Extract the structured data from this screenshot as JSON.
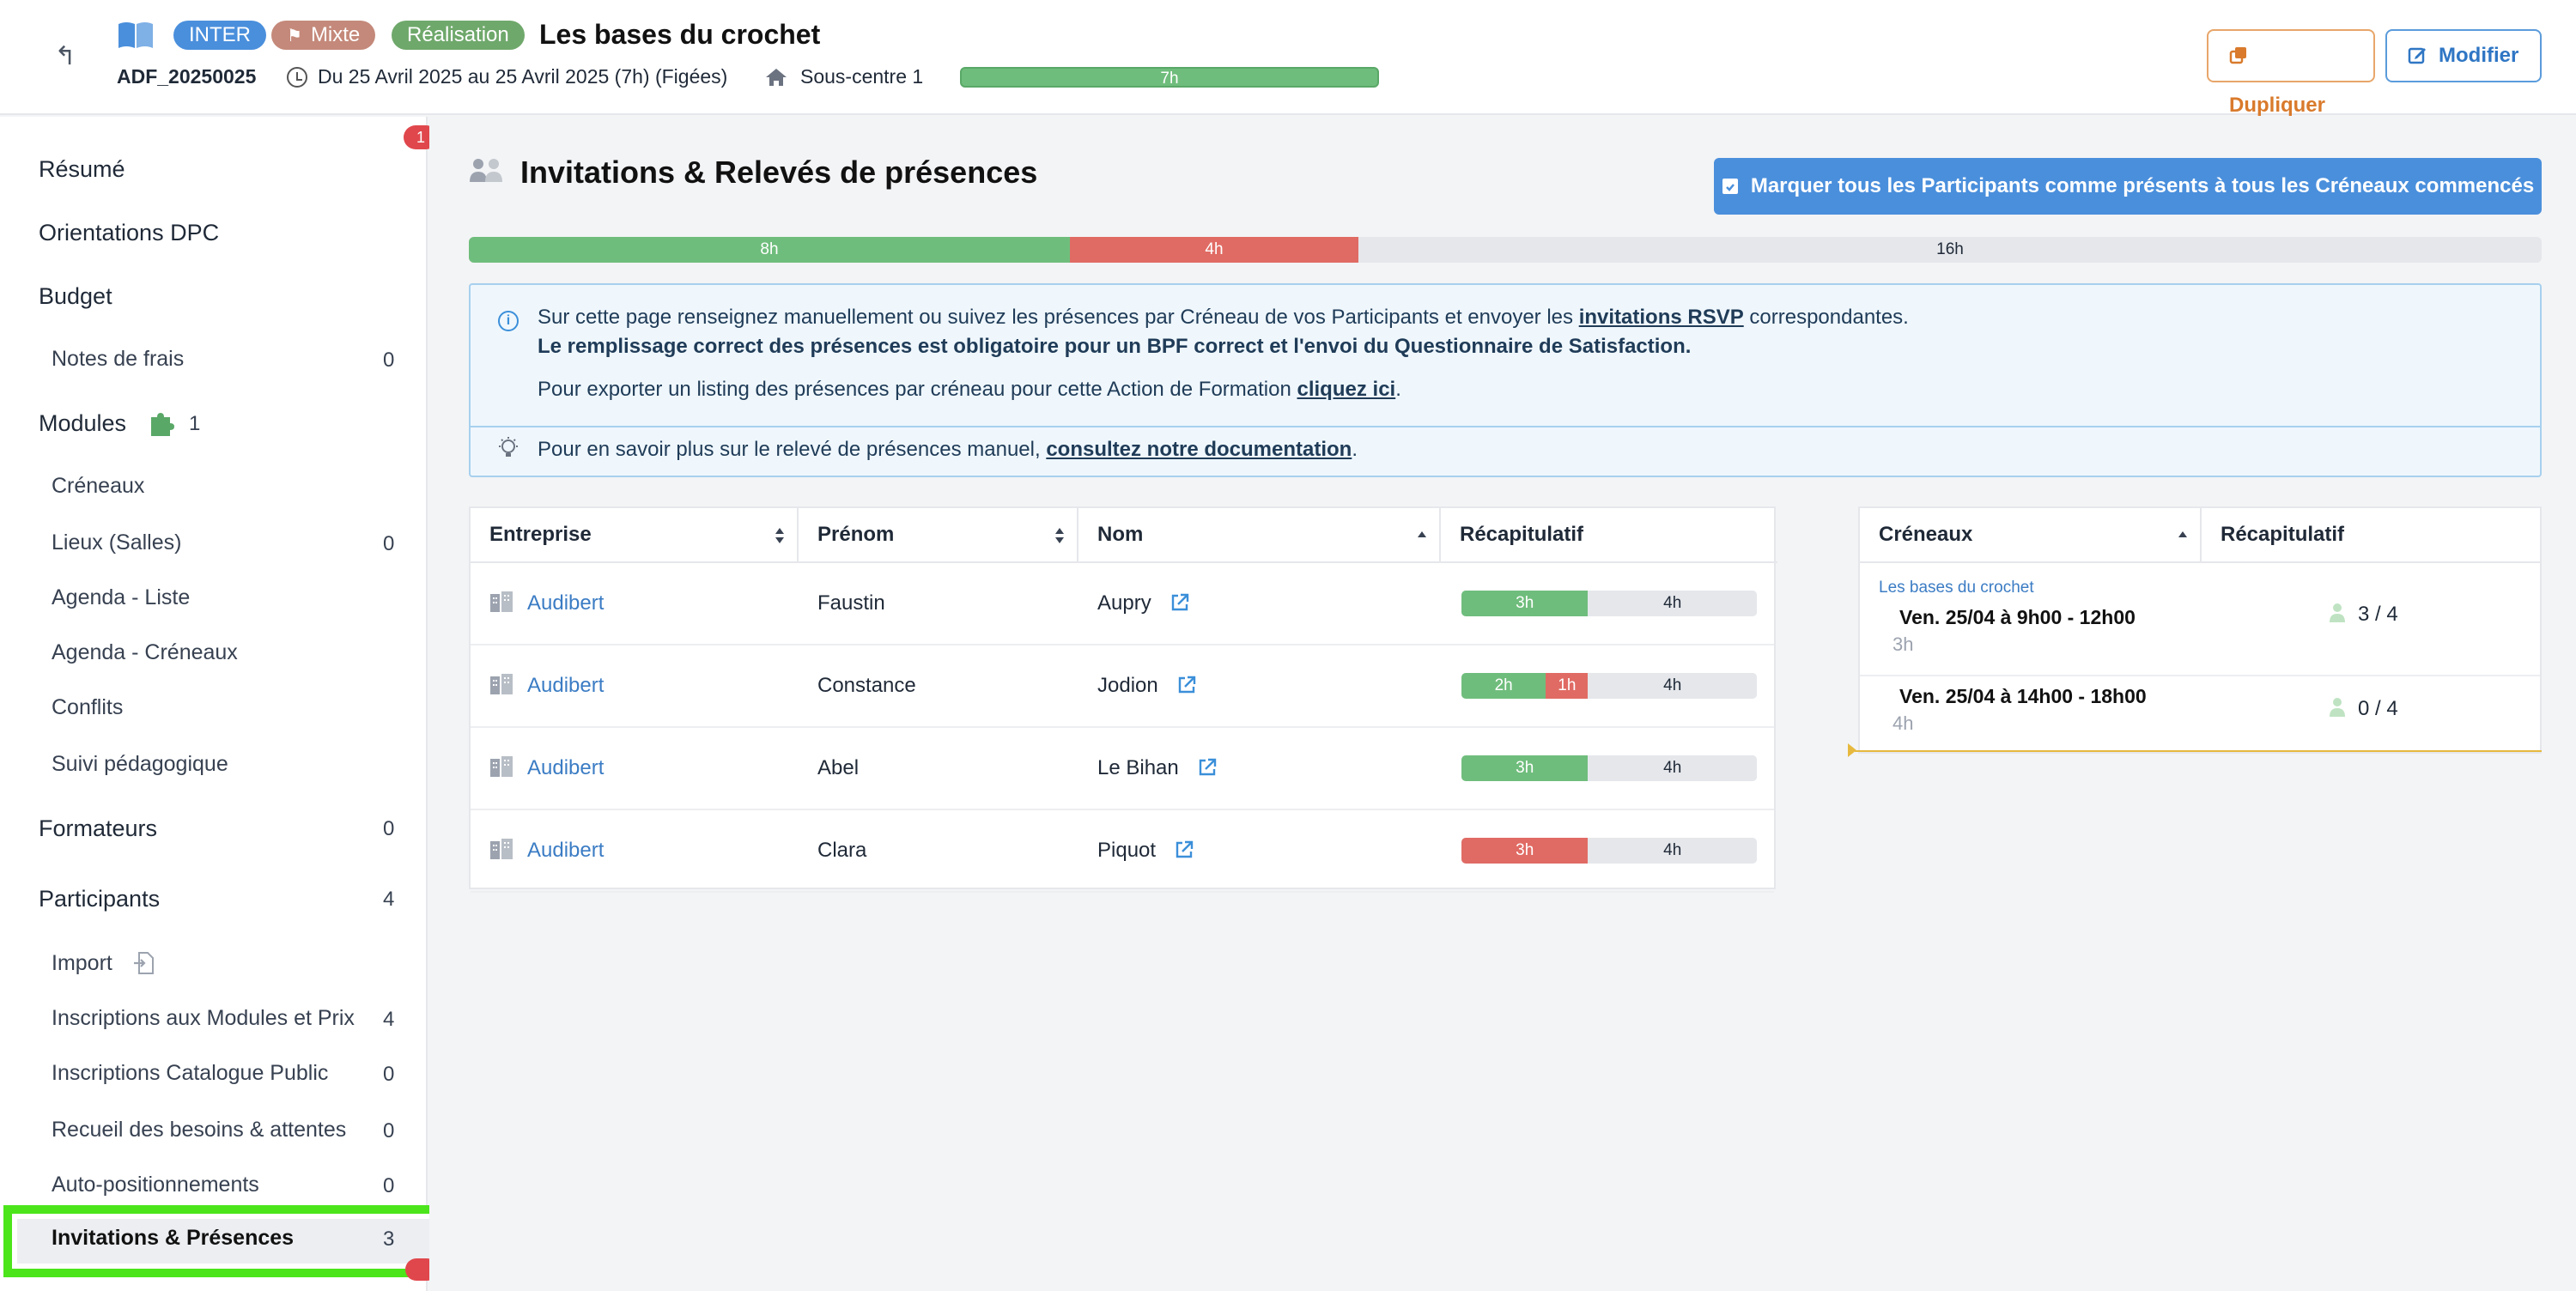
{
  "header": {
    "badges": {
      "inter": "INTER",
      "mixte": "Mixte",
      "realisation": "Réalisation"
    },
    "title": "Les bases du crochet",
    "ref": "ADF_20250025",
    "dates": "Du 25 Avril 2025 au 25 Avril 2025 (7h) (Figées)",
    "center": "Sous-centre 1",
    "progress_label": "7h",
    "duplicate_label": "Dupliquer",
    "modify_label": "Modifier"
  },
  "sidebar": {
    "notif_count": "1",
    "resume": "Résumé",
    "orientations": "Orientations DPC",
    "budget": "Budget",
    "notes": "Notes de frais",
    "notes_count": "0",
    "modules": "Modules",
    "modules_count": "1",
    "creneaux": "Créneaux",
    "lieux": "Lieux (Salles)",
    "lieux_count": "0",
    "agenda_liste": "Agenda - Liste",
    "agenda_creneaux": "Agenda - Créneaux",
    "conflits": "Conflits",
    "suivi": "Suivi pédagogique",
    "formateurs": "Formateurs",
    "formateurs_count": "0",
    "participants": "Participants",
    "participants_count": "4",
    "import": "Import",
    "inscriptions_modules": "Inscriptions aux Modules et Prix",
    "inscriptions_modules_count": "4",
    "inscriptions_catalogue": "Inscriptions Catalogue Public",
    "inscriptions_catalogue_count": "0",
    "recueil": "Recueil des besoins & attentes",
    "recueil_count": "0",
    "auto": "Auto-positionnements",
    "auto_count": "0",
    "invitations": "Invitations & Présences",
    "invitations_count": "3"
  },
  "main": {
    "title": "Invitations & Relevés de présences",
    "mark_all_label": "Marquer tous les Participants comme présents à tous les Créneaux commencés",
    "progress": {
      "present": "8h",
      "absent": "4h",
      "remaining": "16h",
      "present_frac": 0.29,
      "absent_frac": 0.14
    },
    "info": {
      "line1_pre": "Sur cette page renseignez manuellement ou suivez les présences par Créneau de vos Participants et envoyer les ",
      "line1_link": "invitations RSVP",
      "line1_post": " correspondantes.",
      "line2": "Le remplissage correct des présences est obligatoire pour un BPF correct et l'envoi du Questionnaire de Satisfaction.",
      "line3_pre": "Pour exporter un listing des présences par créneau pour cette Action de Formation ",
      "line3_link": "cliquez ici",
      "line3_post": ".",
      "tip_pre": "Pour en savoir plus sur le relevé de présences manuel, ",
      "tip_link": "consultez notre documentation",
      "tip_post": "."
    },
    "table": {
      "headers": {
        "entreprise": "Entreprise",
        "prenom": "Prénom",
        "nom": "Nom",
        "recap": "Récapitulatif"
      },
      "rows": [
        {
          "entreprise": "Audibert",
          "prenom": "Faustin",
          "nom": "Aupry",
          "present": "3h",
          "absent": "",
          "remaining": "4h"
        },
        {
          "entreprise": "Audibert",
          "prenom": "Constance",
          "nom": "Jodion",
          "present": "2h",
          "absent": "1h",
          "remaining": "4h"
        },
        {
          "entreprise": "Audibert",
          "prenom": "Abel",
          "nom": "Le Bihan",
          "present": "3h",
          "absent": "",
          "remaining": "4h"
        },
        {
          "entreprise": "Audibert",
          "prenom": "Clara",
          "nom": "Piquot",
          "present": "",
          "absent": "3h",
          "remaining": "4h"
        }
      ]
    },
    "creneaux": {
      "headers": {
        "creneaux": "Créneaux",
        "recap": "Récapitulatif"
      },
      "group": "Les bases du crochet",
      "items": [
        {
          "title": "Ven. 25/04 à 9h00 - 12h00",
          "duration": "3h",
          "count": "3  /  4"
        },
        {
          "title": "Ven. 25/04 à 14h00 - 18h00",
          "duration": "4h",
          "count": "0  /  4"
        }
      ]
    }
  },
  "colors": {
    "green": "#6fbd7c",
    "red": "#e06b64",
    "blue": "#4a8fdc",
    "orange": "#d97a2c",
    "highlight": "#4ce51c"
  }
}
